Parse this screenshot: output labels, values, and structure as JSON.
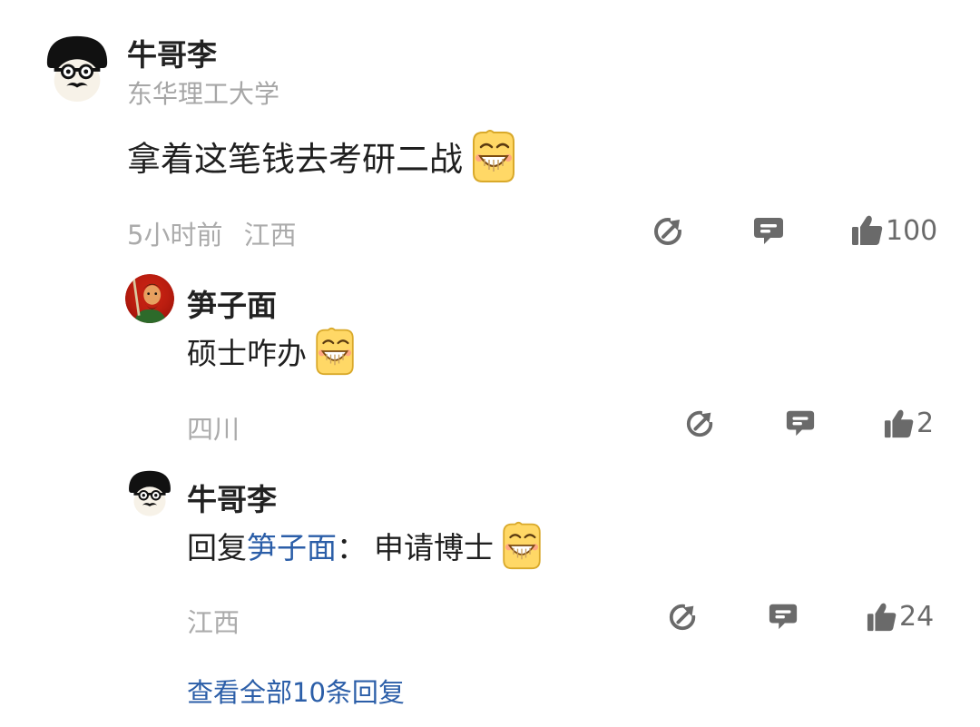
{
  "comment": {
    "author": "牛哥李",
    "school": "东华理工大学",
    "text": "拿着这笔钱去考研二战",
    "time": "5小时前",
    "location": "江西",
    "likes": "100",
    "emoji": "grin-emoji"
  },
  "replies": [
    {
      "author": "笋子面",
      "text": "硕士咋办",
      "location": "四川",
      "likes": "2",
      "emoji": "grin-emoji"
    },
    {
      "author": "牛哥李",
      "reply_prefix": "回复",
      "reply_to": "笋子面",
      "reply_sep": "：",
      "text": "申请博士",
      "location": "江西",
      "likes": "24",
      "emoji": "grin-emoji"
    }
  ],
  "view_all": "查看全部10条回复",
  "colors": {
    "link": "#2b5ea8",
    "meta": "#ababab",
    "icon": "#6a6a6a",
    "emoji_yellow": "#ffd866"
  },
  "icons": [
    "share-icon",
    "reply-icon",
    "like-icon"
  ]
}
